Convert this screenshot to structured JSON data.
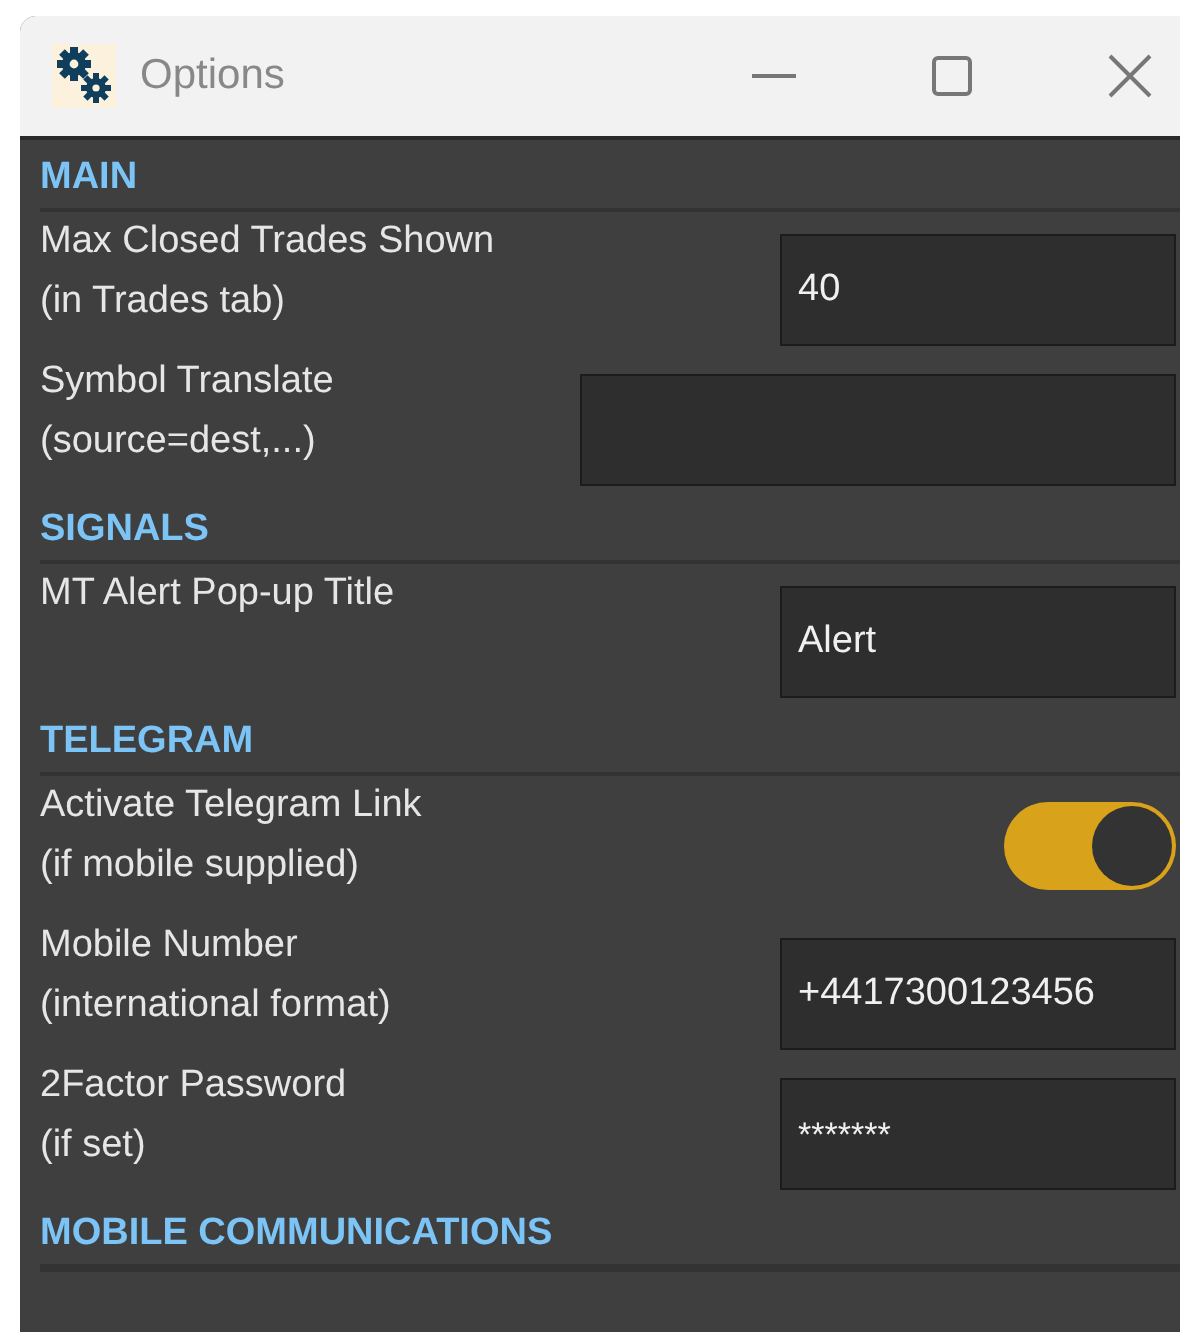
{
  "window": {
    "title": "Options"
  },
  "sections": [
    {
      "title": "MAIN",
      "rows": [
        {
          "kind": "text",
          "label": "Max Closed Trades Shown",
          "hint": "(in Trades tab)",
          "value": "40"
        },
        {
          "kind": "wide",
          "label": "Symbol Translate",
          "hint": "(source=dest,...)"
        }
      ]
    },
    {
      "title": "SIGNALS",
      "rows": [
        {
          "kind": "text",
          "label": "MT Alert Pop-up Title",
          "value": "Alert"
        }
      ]
    },
    {
      "title": "TELEGRAM",
      "rows": [
        {
          "kind": "toggle",
          "label": "Activate Telegram Link",
          "hint": "(if mobile supplied)",
          "on": true
        },
        {
          "kind": "text",
          "label": "Mobile Number",
          "hint": "(international format)",
          "value": "+4417300123456"
        },
        {
          "kind": "password",
          "label": "2Factor Password",
          "hint": "(if set)",
          "value": "*******"
        }
      ]
    },
    {
      "title": "MOBILE COMMUNICATIONS"
    }
  ]
}
